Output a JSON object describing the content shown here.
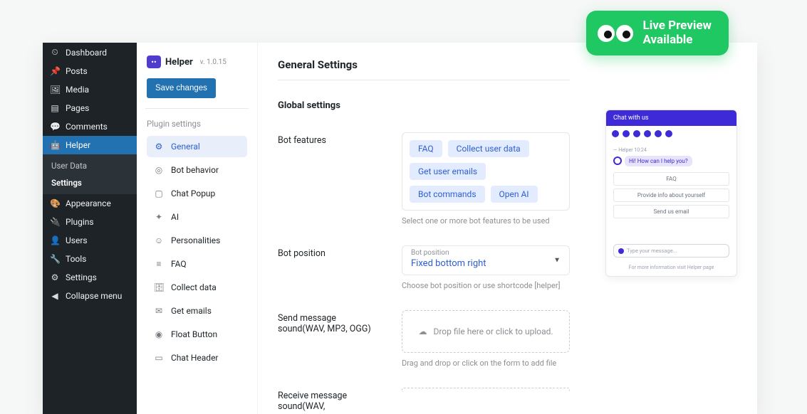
{
  "wp_menu": [
    {
      "icon": "⏲",
      "label": "Dashboard"
    },
    {
      "icon": "📌",
      "label": "Posts"
    },
    {
      "icon": "🖼",
      "label": "Media"
    },
    {
      "icon": "▤",
      "label": "Pages"
    },
    {
      "icon": "💬",
      "label": "Comments"
    },
    {
      "icon": "🤖",
      "label": "Helper",
      "active": true
    },
    {
      "icon": "🎨",
      "label": "Appearance"
    },
    {
      "icon": "🔌",
      "label": "Plugins"
    },
    {
      "icon": "👤",
      "label": "Users"
    },
    {
      "icon": "🔧",
      "label": "Tools"
    },
    {
      "icon": "⚙",
      "label": "Settings"
    },
    {
      "icon": "◀",
      "label": "Collapse menu"
    }
  ],
  "wp_submenu": [
    {
      "label": "User Data"
    },
    {
      "label": "Settings",
      "active": true
    }
  ],
  "plugin": {
    "name": "Helper",
    "version": "v. 1.0.15",
    "save_label": "Save changes",
    "section_label": "Plugin settings",
    "nav": [
      {
        "icon": "⚙",
        "label": "General",
        "active": true
      },
      {
        "icon": "◎",
        "label": "Bot behavior"
      },
      {
        "icon": "▢",
        "label": "Chat Popup"
      },
      {
        "icon": "✦",
        "label": "AI"
      },
      {
        "icon": "☺",
        "label": "Personalities"
      },
      {
        "icon": "≡",
        "label": "FAQ"
      },
      {
        "icon": "🗄",
        "label": "Collect data"
      },
      {
        "icon": "✉",
        "label": "Get emails"
      },
      {
        "icon": "◉",
        "label": "Float Button"
      },
      {
        "icon": "▭",
        "label": "Chat Header"
      }
    ]
  },
  "page": {
    "title": "General Settings",
    "section": "Global settings",
    "bot_features": {
      "label": "Bot features",
      "chips": [
        "FAQ",
        "Collect user data",
        "Get user emails",
        "Bot commands",
        "Open AI"
      ],
      "help": "Select one or more bot features to be used"
    },
    "bot_position": {
      "label": "Bot position",
      "field_label": "Bot position",
      "value": "Fixed bottom right",
      "help": "Choose bot position or use shortcode [helper]"
    },
    "send_sound": {
      "label": "Send message sound(WAV, MP3, OGG)",
      "drop": "Drop file here or click to upload.",
      "help": "Drag and drop or click on the form to add file"
    },
    "receive_sound": {
      "label": "Receive message sound(WAV,"
    }
  },
  "chat": {
    "header": "Chat with us",
    "timestamp": "— Helper 10:24",
    "greeting": "Hi! How can I help you?",
    "suggestions": [
      "FAQ",
      "Provide info about yourself",
      "Send us email"
    ],
    "placeholder": "Type your message...",
    "footer": "For more information visit Helper page"
  },
  "banner": {
    "line1": "Live Preview",
    "line2": "Available"
  }
}
